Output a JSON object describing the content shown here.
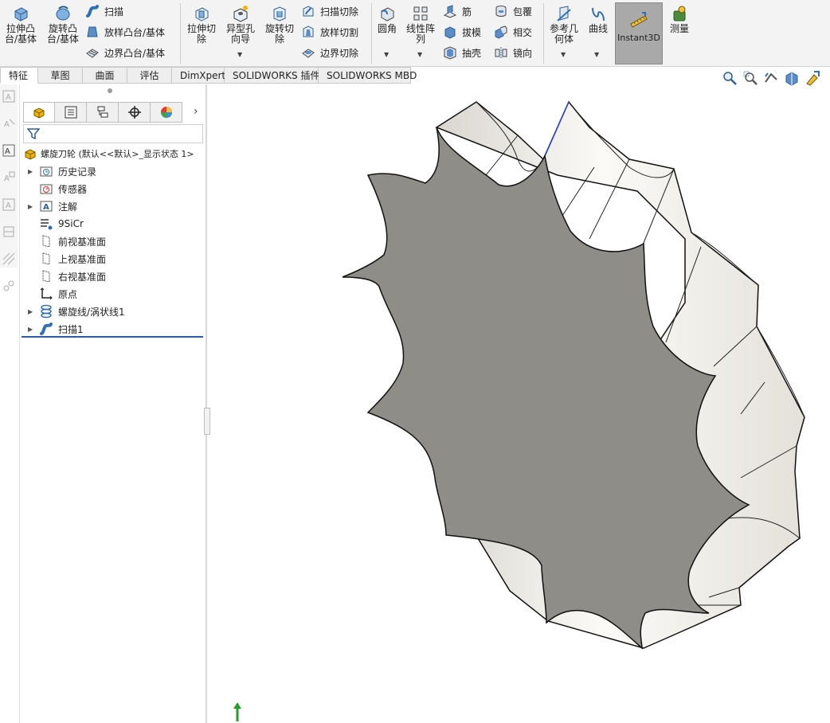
{
  "ribbon": {
    "extrude_boss_line1": "拉伸凸",
    "extrude_boss_line2": "台/基体",
    "revolve_boss_line1": "旋转凸",
    "revolve_boss_line2": "台/基体",
    "sweep": "扫描",
    "loft": "放样凸台/基体",
    "boundary": "边界凸台/基体",
    "extrude_cut_line1": "拉伸切",
    "extrude_cut_line2": "除",
    "hole_wizard_line1": "异型孔",
    "hole_wizard_line2": "向导",
    "revolve_cut_line1": "旋转切",
    "revolve_cut_line2": "除",
    "swept_cut": "扫描切除",
    "lofted_cut": "放样切割",
    "boundary_cut": "边界切除",
    "fillet": "圆角",
    "linear_pattern_line1": "线性阵",
    "linear_pattern_line2": "列",
    "rib": "筋",
    "draft": "拔模",
    "shell": "抽壳",
    "wrap": "包覆",
    "intersect": "相交",
    "mirror": "镜向",
    "ref_geometry_line1": "参考几",
    "ref_geometry_line2": "何体",
    "curves": "曲线",
    "instant3d": "Instant3D",
    "measure": "测量"
  },
  "tabs": [
    "特征",
    "草图",
    "曲面",
    "评估",
    "DimXpert",
    "SOLIDWORKS 插件",
    "SOLIDWORKS MBD"
  ],
  "tree": {
    "root": "螺旋刀轮  (默认<<默认>_显示状态 1>",
    "items": [
      "历史记录",
      "传感器",
      "注解",
      "9SiCr",
      "前视基准面",
      "上视基准面",
      "右视基准面",
      "原点",
      "螺旋线/涡状线1",
      "扫描1"
    ]
  },
  "colors": {
    "ribbon_bg": "#f3f3f3",
    "instant3d_active": "#a9a9a9",
    "face_cut": "#8f8d87",
    "face_shaded": "#f4f2ee",
    "tree_highlight": "#2a5caa"
  }
}
